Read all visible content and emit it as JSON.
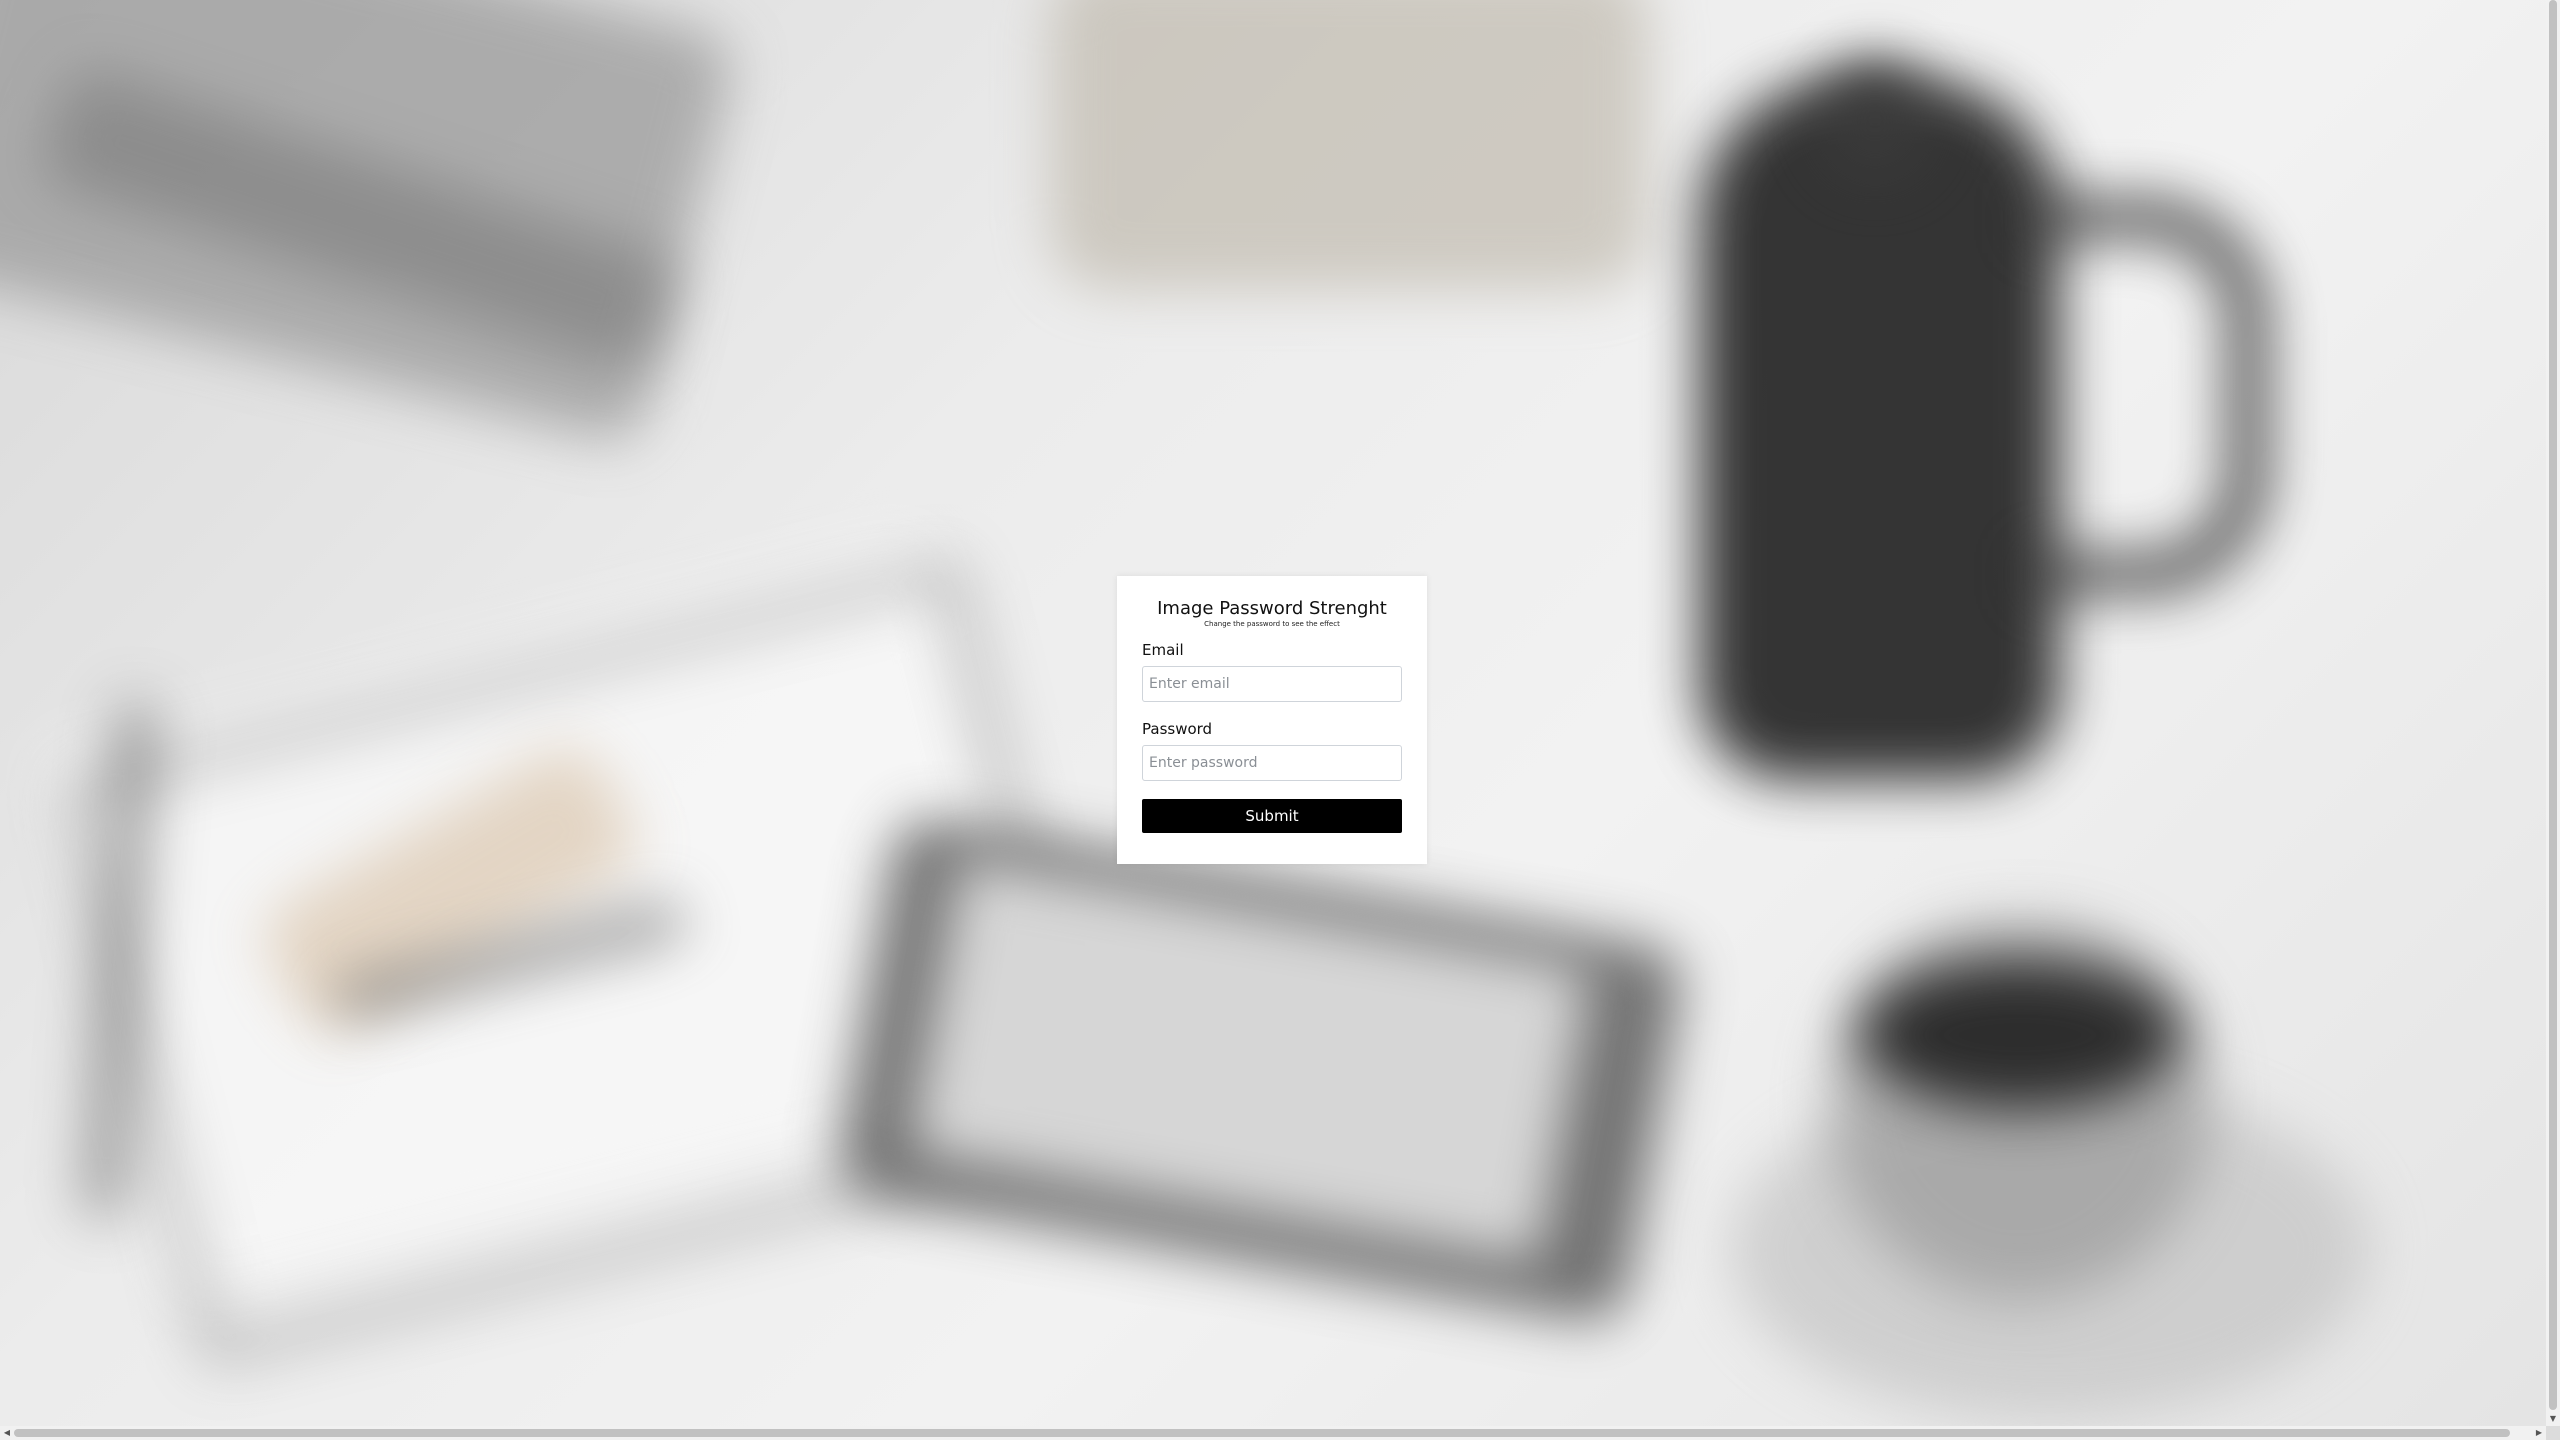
{
  "form": {
    "title": "Image Password Strenght",
    "subtitle": "Change the password to see the effect",
    "email": {
      "label": "Email",
      "placeholder": "Enter email",
      "value": ""
    },
    "password": {
      "label": "Password",
      "placeholder": "Enter password",
      "value": ""
    },
    "submit_label": "Submit"
  },
  "scrollbars": {
    "up_arrow_icon": "▲",
    "down_arrow_icon": "▼",
    "left_arrow_icon": "◀",
    "right_arrow_icon": "▶"
  },
  "colors": {
    "button_background": "#000000",
    "button_text": "#ffffff",
    "card_background": "#ffffff"
  }
}
